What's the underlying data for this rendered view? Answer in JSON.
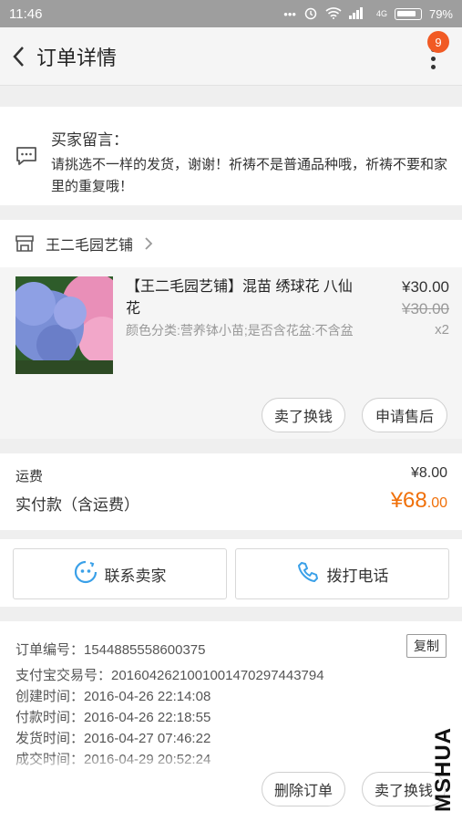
{
  "status_bar": {
    "time": "11:46",
    "dots": "•••",
    "network": "4G",
    "battery": "79%"
  },
  "header": {
    "title": "订单详情",
    "badge_count": "9"
  },
  "buyer_message": {
    "title": "买家留言：",
    "text": "请挑选不一样的发货，谢谢！祈祷不是普通品种哦，祈祷不要和家里的重复哦！"
  },
  "shop": {
    "name": "王二毛园艺铺"
  },
  "product": {
    "title": "【王二毛园艺铺】混苗 绣球花 八仙花",
    "spec": "颜色分类:营养钵小苗;是否含花盆:不含盆",
    "price": "¥30.00",
    "original_price": "¥30.00",
    "quantity": "x2"
  },
  "product_actions": {
    "sell_label": "卖了换钱",
    "aftersale_label": "申请售后"
  },
  "totals": {
    "shipping_label": "运费",
    "shipping_value": "¥8.00",
    "paid_label": "实付款（含运费）",
    "paid_currency_int": "¥68",
    "paid_decimal": ".00"
  },
  "contact": {
    "seller_label": "联系卖家",
    "phone_label": "拨打电话"
  },
  "order_info": {
    "order_no": "订单编号：1544885558600375",
    "copy_label": "复制",
    "alipay_no": "支付宝交易号：2016042621001001470297443794",
    "created": "创建时间：2016-04-26 22:14:08",
    "paid": "付款时间：2016-04-26 22:18:55",
    "shipped": "发货时间：2016-04-27 07:46:22",
    "completed": "成交时间：2016-04-29 20:52:24"
  },
  "bottom_actions": {
    "delete_label": "删除订单",
    "sell_label": "卖了换钱"
  },
  "watermark": "MSHUA",
  "colors": {
    "accent": "#f0700a",
    "badge": "#f15a24",
    "contact_icon": "#3aa0e8"
  }
}
